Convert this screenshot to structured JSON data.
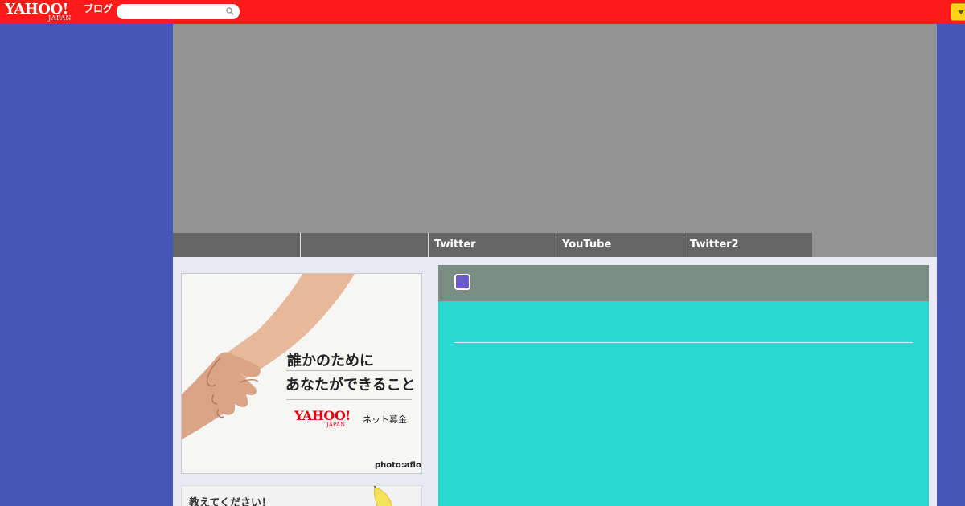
{
  "topbar": {
    "logo": {
      "main": "YAHOO!",
      "sub": "JAPAN",
      "service": "ブログ"
    },
    "search": {
      "placeholder": ""
    },
    "icons": {
      "search": "search-icon",
      "menu": "chevron-down-icon"
    }
  },
  "nav": {
    "items": [
      {
        "label": ""
      },
      {
        "label": ""
      },
      {
        "label": "Twitter"
      },
      {
        "label": "YouTube"
      },
      {
        "label": "Twitter2"
      }
    ]
  },
  "sidebar": {
    "banner": {
      "line1": "誰かのために",
      "line2": "あなたができること",
      "logo": "YAHOO!",
      "logo_sub": "JAPAN",
      "service": "ネット募金",
      "credit": "photo:aflo"
    },
    "box2": {
      "label": "教えてください！"
    }
  },
  "article": {
    "icon": "article-icon"
  },
  "colors": {
    "page_bg": "#4856b8",
    "topbar": "#ff1a1a",
    "header_image": "#939393",
    "nav": "#666666",
    "content_bg": "#e8ebf4",
    "article_head": "#7a8c84",
    "article_body": "#29d9cf",
    "brand_red": "#e60012",
    "accent_yellow": "#ffd21a"
  }
}
